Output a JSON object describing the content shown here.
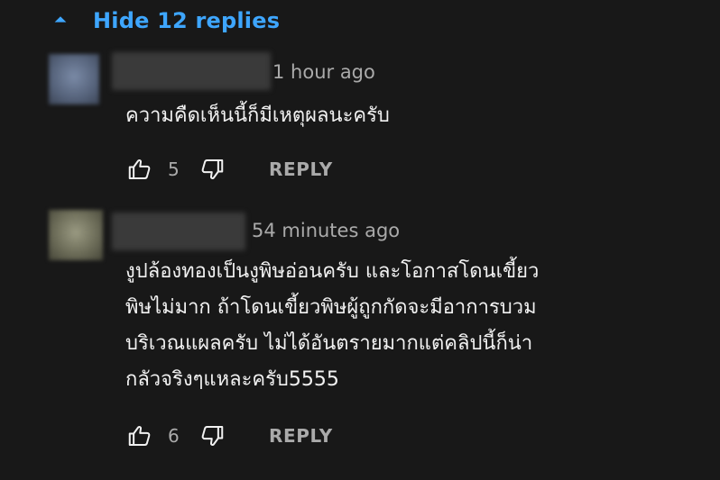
{
  "replies_toggle": {
    "label": "Hide 12 replies",
    "icon": "caret-up-icon",
    "color": "#3ea6ff"
  },
  "comments": [
    {
      "timestamp": "1 hour ago",
      "text": "ความคืดเห็นนี้ก็มีเหตุผลนะครับ",
      "likes": "5",
      "reply_label": "REPLY"
    },
    {
      "timestamp": "54 minutes ago",
      "text": "งูปล้องทองเป็นงูพิษอ่อนครับ และโอกาสโดนเขี้ยว\nพิษไม่มาก ถ้าโดนเขี้ยวพิษผู้ถูกกัดจะมีอาการบวม\nบริเวณแผลครับ ไม่ได้อันตรายมากแต่คลิปนี้ก็น่า\nกลัวจริงๆแหละครับ5555",
      "likes": "6",
      "reply_label": "REPLY"
    }
  ]
}
